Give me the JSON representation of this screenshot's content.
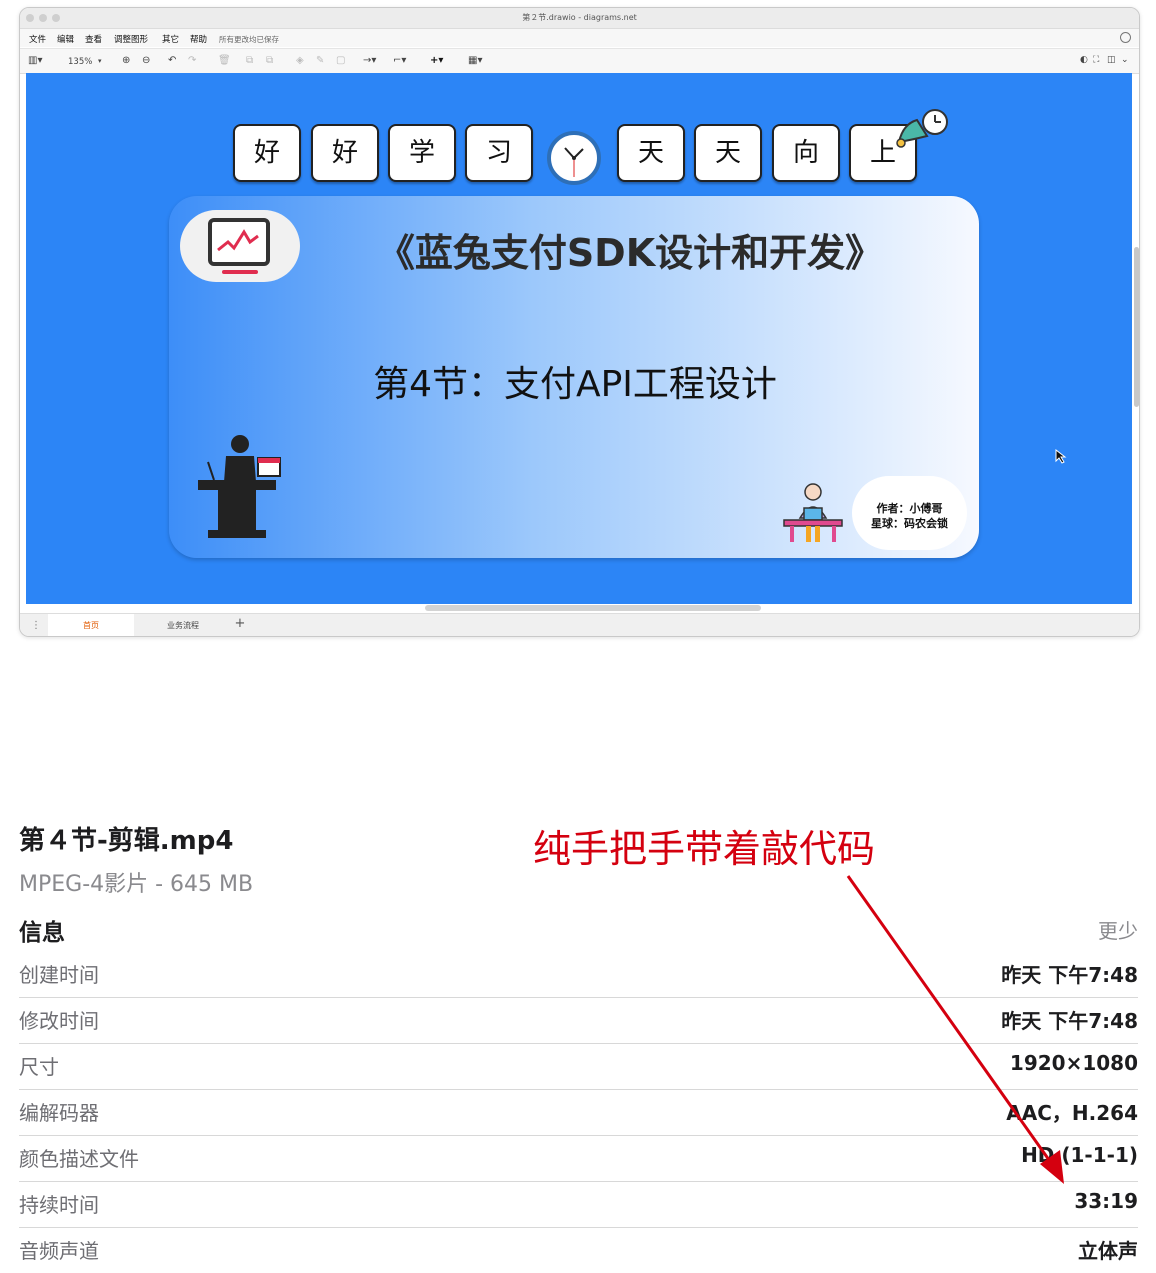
{
  "window": {
    "title": "第２节.drawio - diagrams.net",
    "menu": [
      "文件",
      "编辑",
      "查看",
      "调整图形",
      "其它",
      "帮助"
    ],
    "save_status": "所有更改均已保存",
    "zoom": "135%"
  },
  "slide": {
    "motto_chars": [
      "好",
      "好",
      "学",
      "习",
      "天",
      "天",
      "向",
      "上"
    ],
    "title": "《蓝兔支付SDK设计和开发》",
    "subtitle": "第4节：支付API工程设计",
    "author": "作者：小傅哥",
    "planet": "星球：码农会锁"
  },
  "tabs": [
    "首页",
    "业务流程"
  ],
  "file": {
    "name": "第４节-剪辑.mp4",
    "kind": "MPEG-4影片 - 645 MB"
  },
  "annotation": "纯手把手带着敲代码",
  "info": {
    "title": "信息",
    "less": "更少",
    "rows": [
      {
        "label": "创建时间",
        "value": "昨天 下午7:48"
      },
      {
        "label": "修改时间",
        "value": "昨天 下午7:48"
      },
      {
        "label": "尺寸",
        "value": "1920×1080"
      },
      {
        "label": "编解码器",
        "value": "AAC，H.264"
      },
      {
        "label": "颜色描述文件",
        "value": "HD (1-1-1)"
      },
      {
        "label": "持续时间",
        "value": "33:19"
      },
      {
        "label": "音频声道",
        "value": "立体声"
      }
    ]
  },
  "colors": {
    "canvas": "#2c85f6",
    "annotation": "#d4000f",
    "tab_active": "#e05a00"
  }
}
